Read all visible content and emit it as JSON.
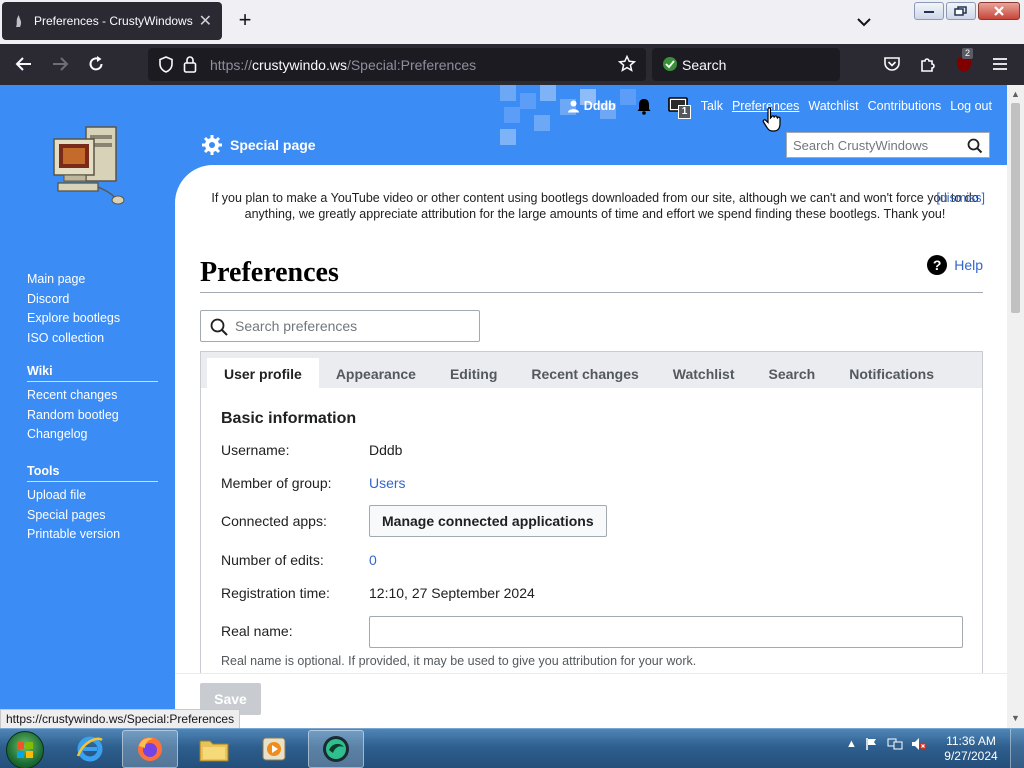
{
  "browser": {
    "tab_title": "Preferences - CrustyWindows",
    "url_scheme": "https://",
    "url_domain": "crustywindo.ws",
    "url_path": "/Special:Preferences",
    "search_placeholder": "Search",
    "extension_badge": "2"
  },
  "wiki": {
    "personal": {
      "username": "Dddb",
      "notifications_badge": "1",
      "links": [
        "Talk",
        "Preferences",
        "Watchlist",
        "Contributions",
        "Log out"
      ]
    },
    "special_page_label": "Special page",
    "search_placeholder": "Search CrustyWindows",
    "sidebar": {
      "main": [
        "Main page",
        "Discord",
        "Explore bootlegs",
        "ISO collection"
      ],
      "wiki_heading": "Wiki",
      "wiki": [
        "Recent changes",
        "Random bootleg",
        "Changelog"
      ],
      "tools_heading": "Tools",
      "tools": [
        "Upload file",
        "Special pages",
        "Printable version"
      ]
    },
    "sitenotice": {
      "text": "If you plan to make a YouTube video or other content using bootlegs downloaded from our site, although we can't and won't force you to do anything, we greatly appreciate attribution for the large amounts of time and effort we spend finding these bootlegs. Thank you!",
      "dismiss": "[dismiss]"
    },
    "page_title": "Preferences",
    "help_label": "Help",
    "pref_search_placeholder": "Search preferences",
    "tabs": [
      "User profile",
      "Appearance",
      "Editing",
      "Recent changes",
      "Watchlist",
      "Search",
      "Notifications"
    ],
    "basic": {
      "section_title": "Basic information",
      "username_label": "Username:",
      "username_value": "Dddb",
      "group_label": "Member of group:",
      "group_value": "Users",
      "apps_label": "Connected apps:",
      "apps_button": "Manage connected applications",
      "edits_label": "Number of edits:",
      "edits_value": "0",
      "registration_label": "Registration time:",
      "registration_value": "12:10, 27 September 2024",
      "realname_label": "Real name:",
      "realname_value": "",
      "realname_hint": "Real name is optional. If provided, it may be used to give you attribution for your work."
    },
    "save_label": "Save"
  },
  "status_link": "https://crustywindo.ws/Special:Preferences",
  "taskbar": {
    "time": "11:36 AM",
    "date": "9/27/2024"
  }
}
